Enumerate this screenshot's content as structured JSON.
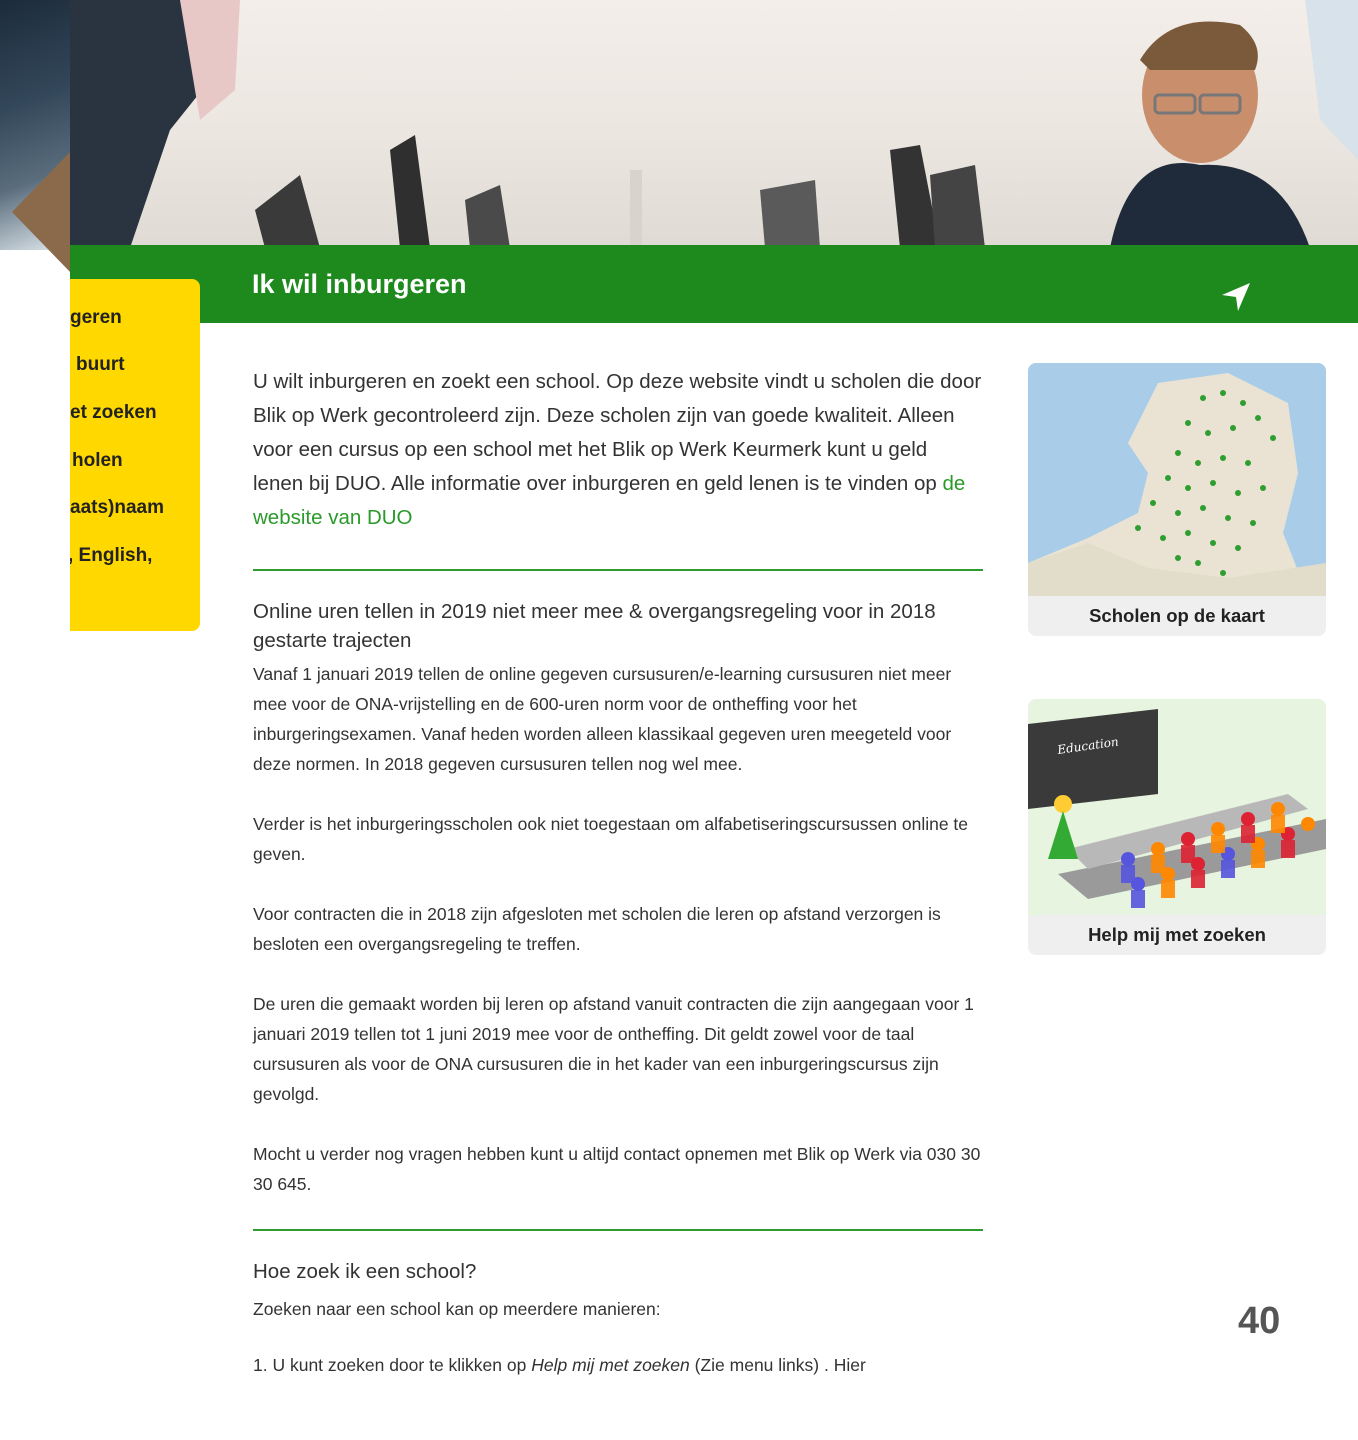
{
  "header": {
    "title": "Ik wil inburgeren"
  },
  "side_menu": {
    "items": [
      {
        "label": "geren"
      },
      {
        "label": "buurt"
      },
      {
        "label": "et zoeken"
      },
      {
        "label": "holen"
      },
      {
        "label": "aats)naam"
      },
      {
        "label": ", English,"
      }
    ]
  },
  "intro": {
    "text": "U wilt inburgeren en zoekt een school. Op deze website vindt u scholen die door Blik op Werk gecontroleerd zijn. Deze scholen zijn van goede kwaliteit. Alleen voor een cursus op een school met het Blik op Werk Keurmerk kunt u geld lenen bij DUO. Alle informatie over inburgeren en geld lenen is te vinden op ",
    "link_label": "de website van DUO"
  },
  "news": {
    "title": "Online uren tellen in 2019 niet meer mee & overgangsregeling voor in 2018 gestarte trajecten",
    "paragraphs": [
      "Vanaf 1 januari 2019 tellen de online gegeven cursusuren/e-learning cursusuren niet meer mee voor de ONA-vrijstelling en de 600-uren norm voor de ontheffing voor het inburgeringsexamen. Vanaf heden worden alleen klassikaal gegeven uren meegeteld voor deze normen. In 2018 gegeven cursusuren tellen nog wel mee.",
      "Verder is het inburgeringsscholen ook niet toegestaan om alfabetiseringscursussen online te geven.",
      "Voor contracten die in 2018 zijn afgesloten met scholen die leren op afstand verzorgen is besloten een overgangsregeling te treffen.",
      "De uren die gemaakt worden bij leren op afstand vanuit contracten die zijn aangegaan voor 1 januari 2019 tellen tot 1 juni 2019 mee voor de ontheffing. Dit geldt zowel voor de taal cursusuren  als voor de ONA cursusuren die in het kader van een inburgeringscursus zijn gevolgd.",
      "Mocht u verder nog vragen hebben kunt u altijd contact opnemen met Blik op Werk via 030 30 30 645."
    ]
  },
  "how_to": {
    "title": "Hoe zoek ik een school?",
    "lead": "Zoeken naar een school kan op meerdere manieren:",
    "item1_prefix": "1. U kunt zoeken door te klikken op ",
    "item1_emph": "Help mij met zoeken",
    "item1_suffix": " (Zie menu links) . Hier"
  },
  "cards": {
    "map_caption": "Scholen op de kaart",
    "help_caption": "Help mij met zoeken",
    "help_board_text": "Education"
  },
  "page_number": "40",
  "icons": {
    "nav": "navigation-arrow-icon"
  },
  "colors": {
    "brand_green": "#1e8a1e",
    "menu_yellow": "#ffd800",
    "link_green": "#2a9a2a"
  }
}
